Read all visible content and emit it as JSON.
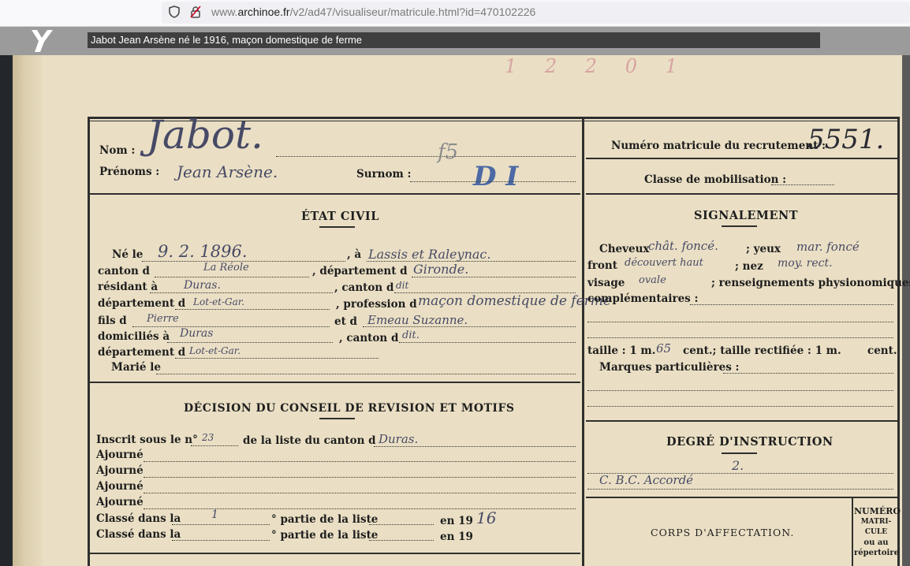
{
  "browser": {
    "url_prefix": "www.",
    "url_domain": "archinoe.fr",
    "url_path": "/v2/ad47/visualiseur/matricule.html?id=470102226"
  },
  "viewer": {
    "title": "Jabot Jean Arsène né le 1916, maçon domestique de ferme"
  },
  "doc": {
    "labels": {
      "nom": "Nom :",
      "prenoms": "Prénoms :",
      "surnom": "Surnom :",
      "matricule": "Numéro matricule du recrutement :",
      "classe_mob": "Classe de mobilisation :",
      "etat_civil": "ÉTAT CIVIL",
      "signalement": "SIGNALEMENT",
      "ne_le": "Né le",
      "a": ", à",
      "canton_d": "canton d",
      "departement_d_1": ", département d",
      "residant": "résidant à",
      "canton_d2": ", canton d",
      "departement_d": "département d",
      "profession": ", profession d",
      "fils_d": "fils d",
      "et_d": "et d",
      "domicilies": "domiciliés à",
      "canton_d3": ", canton d",
      "departement_d3": "département d",
      "marie": "Marié le",
      "cheveux": "Cheveux",
      "yeux": "; yeux",
      "front": "front",
      "nez": "; nez",
      "visage": "visage",
      "renseignements": "; renseignements physionomiques",
      "complementaires": "complémentaires :",
      "taille": "taille : 1 m.",
      "cent": "cent.; taille rectifiée : 1 m.",
      "cent_end": "cent.",
      "marques": "Marques particulières :",
      "decision": "DÉCISION DU CONSEIL DE REVISION ET MOTIFS",
      "inscrit": "Inscrit sous le n°",
      "liste_canton": "de la liste du canton d",
      "ajourne": "Ajourné",
      "classe_dans": "Classé dans la",
      "partie": "° partie de la liste",
      "en19": "en 19",
      "degre": "DEGRÉ D'INSTRUCTION",
      "corps": "CORPS D'AFFECTATION.",
      "numero_col": [
        "NUMÉRO",
        "MATRI-",
        "CULE",
        "ou au",
        "répertoire"
      ]
    },
    "values": {
      "nom": "Jabot.",
      "prenoms": "Jean Arsène.",
      "surnom_mark": "f5",
      "matricule": "5551.",
      "ne_le": "9. 2. 1896.",
      "lieu": "Lassis et Raleynac.",
      "canton": "La Réole",
      "departement": "Gironde.",
      "residant": "Duras.",
      "canton_res": "dit",
      "dep_res": "Lot-et-Gar.",
      "profession": "maçon domestique de ferme",
      "pere": "Pierre",
      "mere": "Emeau Suzanne.",
      "domicilies": "Duras",
      "canton_dom": "dit.",
      "dep_dom": "Lot-et-Gar.",
      "cheveux": "chât. foncé.",
      "yeux": "mar. foncé",
      "front": "découvert haut",
      "nez": "moy. rect.",
      "visage": "ovale",
      "taille": "65",
      "inscrit_num": "23",
      "inscrit_canton": "Duras.",
      "classe_partie": "1",
      "classe_annee": "16",
      "instruction": "2.",
      "instruction_note": "C. B.C. Accordé",
      "corner_stamp": "D I",
      "top_stamp": "1 2 2 0 1"
    }
  }
}
